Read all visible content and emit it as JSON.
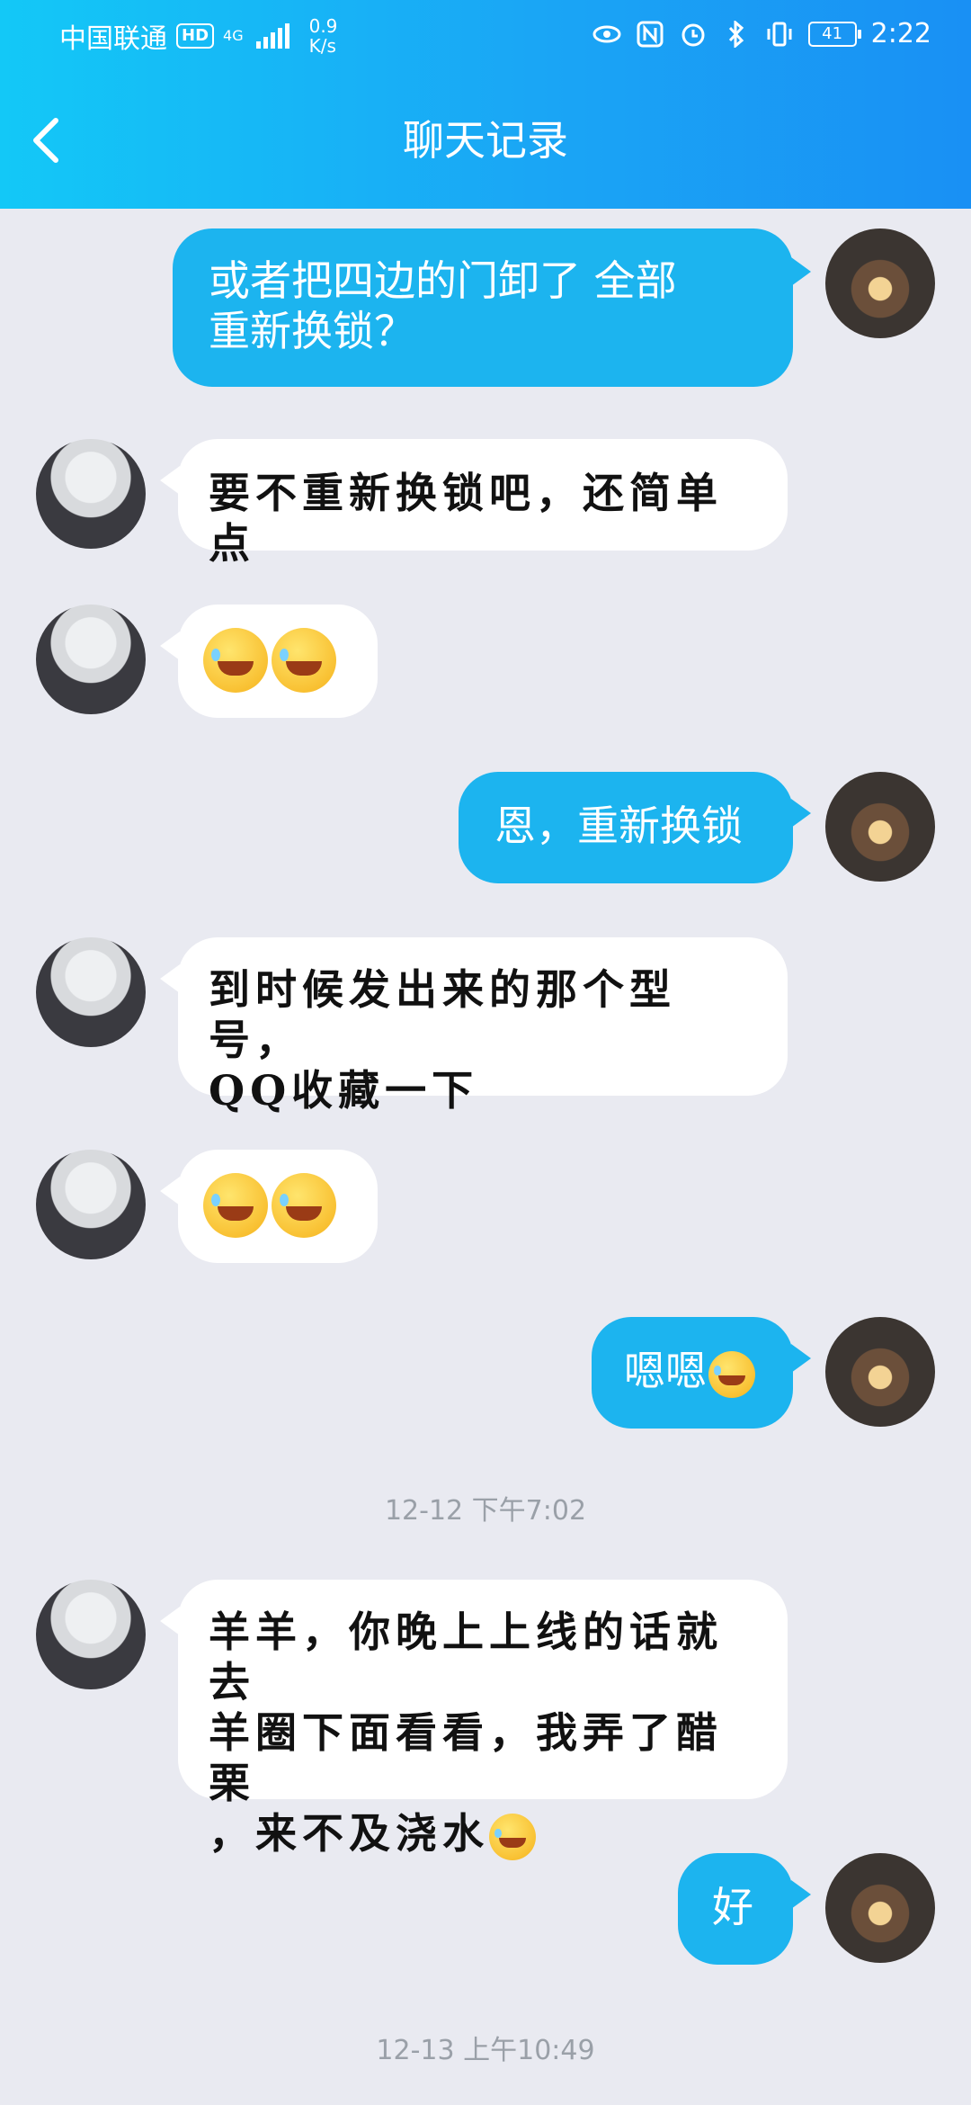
{
  "status_bar": {
    "carrier": "中国联通",
    "hd": "HD",
    "network": "4G",
    "speed_value": "0.9",
    "speed_unit": "K/s",
    "battery": "41",
    "time": "2:22"
  },
  "header": {
    "title": "聊天记录"
  },
  "messages": [
    {
      "side": "me",
      "text1": "或者把四边的门卸了  全部",
      "text2": "重新换锁？"
    },
    {
      "side": "them",
      "text": "要不重新换锁吧，还简单点"
    },
    {
      "side": "them",
      "emoji": "facepalm-laugh-emoji"
    },
    {
      "side": "me",
      "text": "恩，重新换锁"
    },
    {
      "side": "them",
      "text1": "到时候发出来的那个型号，",
      "text2": "QQ收藏一下"
    },
    {
      "side": "them",
      "emoji": "tears-of-joy-emoji"
    },
    {
      "side": "me",
      "text": "嗯嗯"
    },
    {
      "side": "them",
      "text1": "羊羊，你晚上上线的话就去",
      "text2": "羊圈下面看看，我弄了醋栗",
      "text3": "，来不及浇水"
    },
    {
      "side": "me",
      "text": "好"
    }
  ],
  "timestamps": [
    "12-12 下午7:02",
    "12-13 上午10:49"
  ],
  "colors": {
    "header_start": "#13c8f7",
    "header_end": "#1990f4",
    "my_bubble": "#1cb4ef",
    "their_bubble": "#ffffff",
    "background": "#e9eaf1"
  }
}
